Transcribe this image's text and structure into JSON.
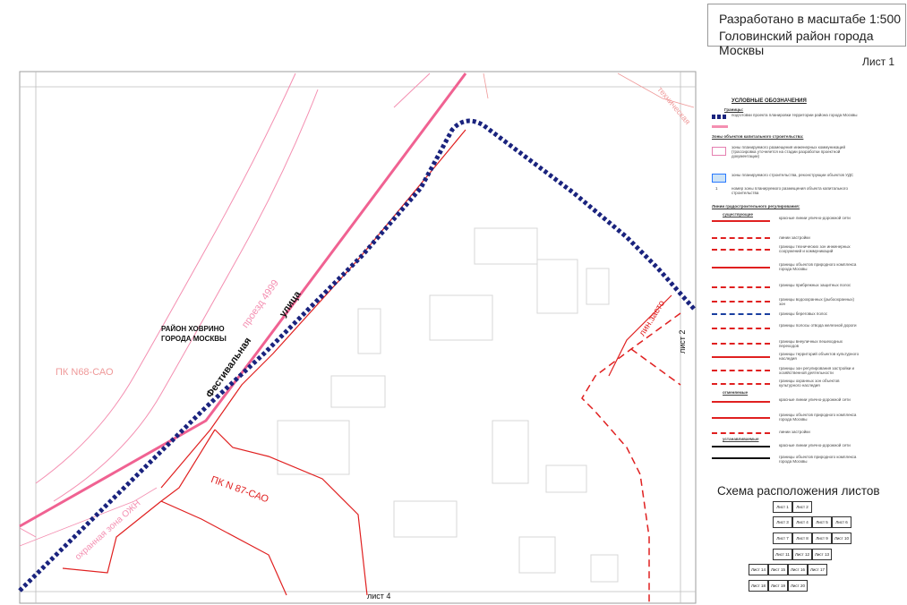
{
  "title_block": {
    "line1": "Разработано в масштабе 1:500",
    "line2": "Головинский район города Москвы"
  },
  "sheet_label": "Лист 1",
  "map": {
    "district": "РАЙОН ХОВРИНО\nГОРОДА МОСКВЫ",
    "district_line1": "РАЙОН ХОВРИНО",
    "district_line2": "ГОРОДА МОСКВЫ",
    "street_1": "Фестивальная",
    "street_2": "улица",
    "passage": "проезд 4999",
    "pk68": "ПК N68-САО",
    "pk87": "ПК N 87-САО",
    "zone_ozh": "охранная зона ОЖН",
    "sheet2": "лист 2",
    "sheet4": "лист 4",
    "tech_zone": "техническая",
    "zasto_line": "лин.засто",
    "colors": {
      "boundary_dash": "#1a237e",
      "red_line": "#e02020",
      "pink_line": "#f48fb1",
      "grey_building": "#cfcfcf"
    }
  },
  "legend": {
    "title": "УСЛОВНЫЕ ОБОЗНАЧЕНИЯ",
    "borders_header": "Границы:",
    "b1": "подготовки проекта планировки территории района города Москвы",
    "zones_header": "Зоны объектов капитального строительства:",
    "z1": "зоны планируемого размещения инженерных коммуникаций (трассировка уточняется на стадии разработки проектной документации)",
    "z2": "зоны планируемого строительства, реконструкции объектов УДС",
    "z3_num": "1",
    "z3": "номер зоны планируемого размещения объекта капитального строительства",
    "lines_header": "Линии градостроительного регулирования:",
    "existing": "существующие",
    "items": [
      "красные линии улично-дорожной сети",
      "линии застройки",
      "границы технических зон инженерных сооружений и коммуникаций",
      "границы объектов природного комплекса города Москвы",
      "границы прибрежных защитных полос",
      "границы водоохранных (рыбоохранных) зон",
      "границы береговых полос",
      "границы полосы отвода железной дороги",
      "границы внеуличных пешеходных переходов",
      "границы территорий объектов культурного наследия",
      "границы зон регулирования застройки и хозяйственной деятельности",
      "границы охранных зон объектов культурного наследия"
    ],
    "cancelled": "отменяемые",
    "cancelled_items": [
      "красные линии улично-дорожной сети",
      "границы объектов природного комплекса города Москвы",
      "линии застройки"
    ],
    "established": "устанавливаемые",
    "established_items": [
      "красные линии улично-дорожной сети",
      "границы объектов природного комплекса города Москвы"
    ]
  },
  "scheme": {
    "title": "Схема расположения листов",
    "cells": [
      "Лист 1",
      "Лист 2",
      "Лист 3",
      "Лист 4",
      "Лист 5",
      "Лист 6",
      "Лист 7",
      "Лист 8",
      "Лист 9",
      "Лист 10",
      "Лист 11",
      "Лист 12",
      "Лист 13",
      "Лист 14",
      "Лист 15",
      "Лист 16",
      "Лист 17",
      "Лист 18",
      "Лист 19",
      "Лист 20"
    ]
  }
}
